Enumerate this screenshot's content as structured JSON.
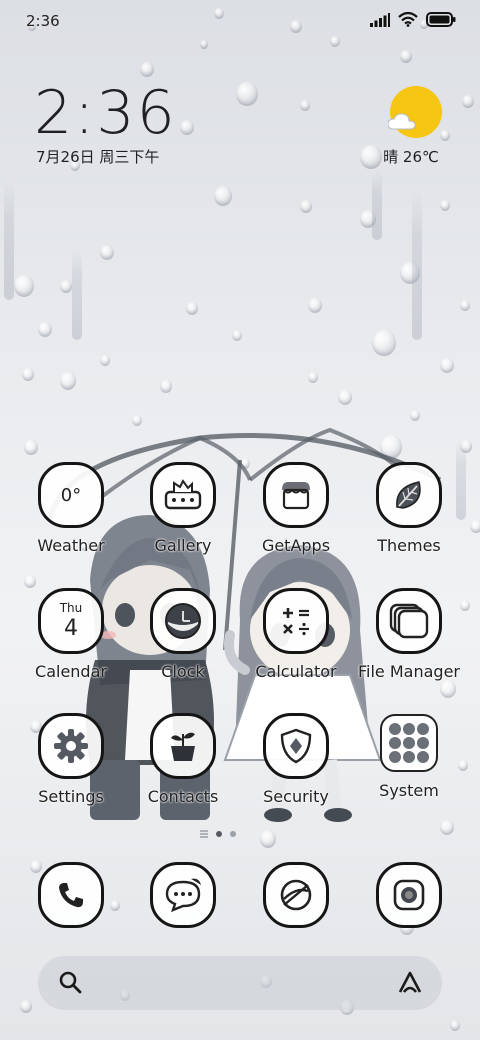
{
  "status_bar": {
    "time": "2:36"
  },
  "clock_widget": {
    "time": "2:36",
    "date": "7月26日 周三下午"
  },
  "weather_widget": {
    "text": "晴 26℃",
    "sun_color": "#f7c613"
  },
  "apps": [
    {
      "name": "weather",
      "label": "Weather",
      "icon": "weather-icon",
      "inner_text": "0°"
    },
    {
      "name": "gallery",
      "label": "Gallery",
      "icon": "gallery-icon"
    },
    {
      "name": "getapps",
      "label": "GetApps",
      "icon": "store-icon"
    },
    {
      "name": "themes",
      "label": "Themes",
      "icon": "leaf-icon"
    },
    {
      "name": "calendar",
      "label": "Calendar",
      "icon": "calendar-icon",
      "day": "Thu",
      "date": "4"
    },
    {
      "name": "clock",
      "label": "Clock",
      "icon": "clock-icon"
    },
    {
      "name": "calculator",
      "label": "Calculator",
      "icon": "calculator-icon"
    },
    {
      "name": "file-manager",
      "label": "File Manager",
      "icon": "folder-icon"
    },
    {
      "name": "settings",
      "label": "Settings",
      "icon": "gear-icon"
    },
    {
      "name": "contacts",
      "label": "Contacts",
      "icon": "plant-pot-icon"
    },
    {
      "name": "security",
      "label": "Security",
      "icon": "shield-icon"
    },
    {
      "name": "system",
      "label": "System",
      "icon": "app-folder-icon"
    }
  ],
  "page_indicator": {
    "pages": 2,
    "current": 1
  },
  "dock": [
    {
      "name": "phone",
      "icon": "phone-icon"
    },
    {
      "name": "messages",
      "icon": "chat-bubble-icon"
    },
    {
      "name": "browser",
      "icon": "globe-icon"
    },
    {
      "name": "camera",
      "icon": "camera-icon"
    }
  ],
  "search_bar": {
    "left_icon": "search-icon",
    "right_icon": "assistant-icon"
  },
  "colors": {
    "icon_border": "#151515",
    "text": "#222222"
  }
}
